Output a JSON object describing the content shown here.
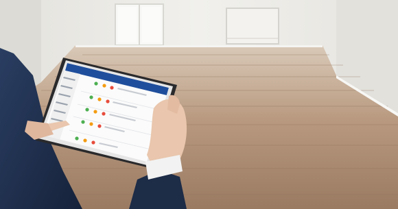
{
  "scene": {
    "colors": {
      "wall": "#ecebe6",
      "window_light": "#f6f6f3",
      "floor_light": "#c9b4a0",
      "floor_dark": "#8a6b52",
      "tablet_frame": "#2a2a2c",
      "app_bar": "#1f4e9c",
      "status_green": "#4caf50",
      "status_orange": "#f39c12",
      "status_red": "#e74c3c",
      "suit": "#1f2f4a",
      "skin": "#e9c6ad"
    }
  }
}
